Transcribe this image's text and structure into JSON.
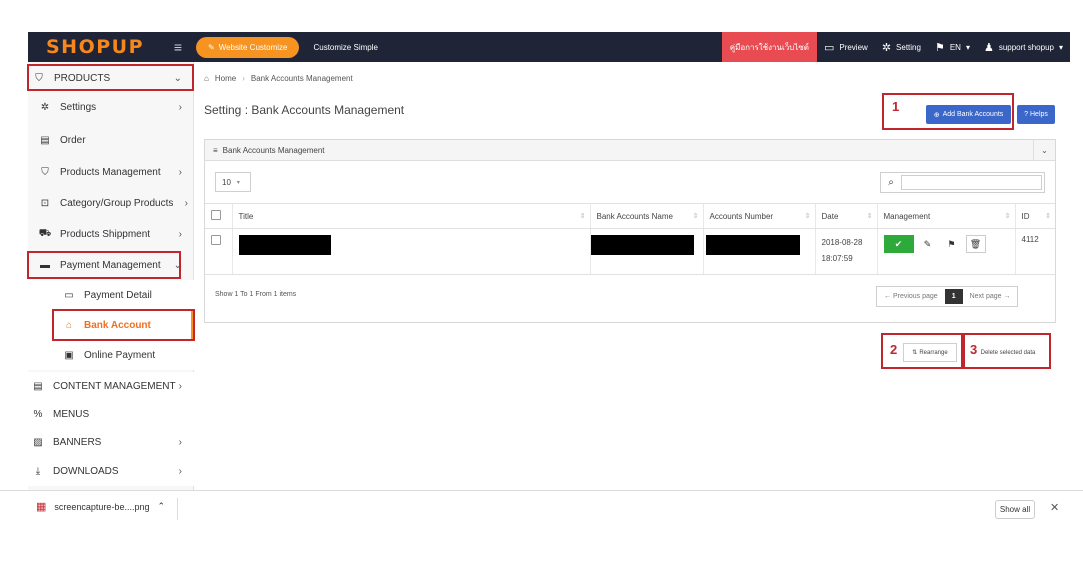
{
  "topbar": {
    "logo": "SHOPUP",
    "menu_icon": "hamburger-icon",
    "website_customize": "Website Customize",
    "customize_simple": "Customize Simple",
    "manual": "คู่มือการใช้งานเว็บไซต์",
    "preview": "Preview",
    "setting": "Setting",
    "language": "EN",
    "user": "support shopup"
  },
  "sidebar": {
    "products": "PRODUCTS",
    "settings": "Settings",
    "order": "Order",
    "products_management": "Products Management",
    "category_group": "Category/Group Products",
    "products_shippment": "Products Shippment",
    "payment_management": "Payment Management",
    "payment_detail": "Payment Detail",
    "bank_account": "Bank Account",
    "online_payment": "Online Payment",
    "content_management": "CONTENT MANAGEMENT",
    "menus": "MENUS",
    "banners": "BANNERS",
    "downloads": "DOWNLOADS"
  },
  "breadcrumb": {
    "home": "Home",
    "current": "Bank Accounts Management"
  },
  "page": {
    "title": "Setting : Bank Accounts Management",
    "add_button": "Add Bank Accounts",
    "helps_button": "Helps",
    "marker_1": "1",
    "marker_2": "2",
    "marker_3": "3"
  },
  "panel": {
    "title": "Bank Accounts Management",
    "page_size": "10",
    "search_placeholder": "",
    "columns": [
      "Title",
      "Bank Accounts Name",
      "Accounts Number",
      "Date",
      "Management",
      "ID"
    ],
    "rows": [
      {
        "title": "",
        "bank_name": "",
        "account_number": "",
        "date": "2018-08-28",
        "time": "18:07:59",
        "id": "4112"
      }
    ],
    "info": "Show 1 To 1 From 1 items",
    "prev_page": "← Previous page",
    "current_page": "1",
    "next_page": "Next page →"
  },
  "actions": {
    "rearrange": "Rearrange",
    "delete_selected": "Delete selected data"
  },
  "downloads_bar": {
    "file": "screencapture-be....png",
    "show_all": "Show all"
  },
  "colors": {
    "accent_orange": "#f79320",
    "topbar": "#1f2437",
    "primary_blue": "#3a67c9",
    "highlight_red": "#c0262d",
    "success_green": "#2eaa3a"
  }
}
